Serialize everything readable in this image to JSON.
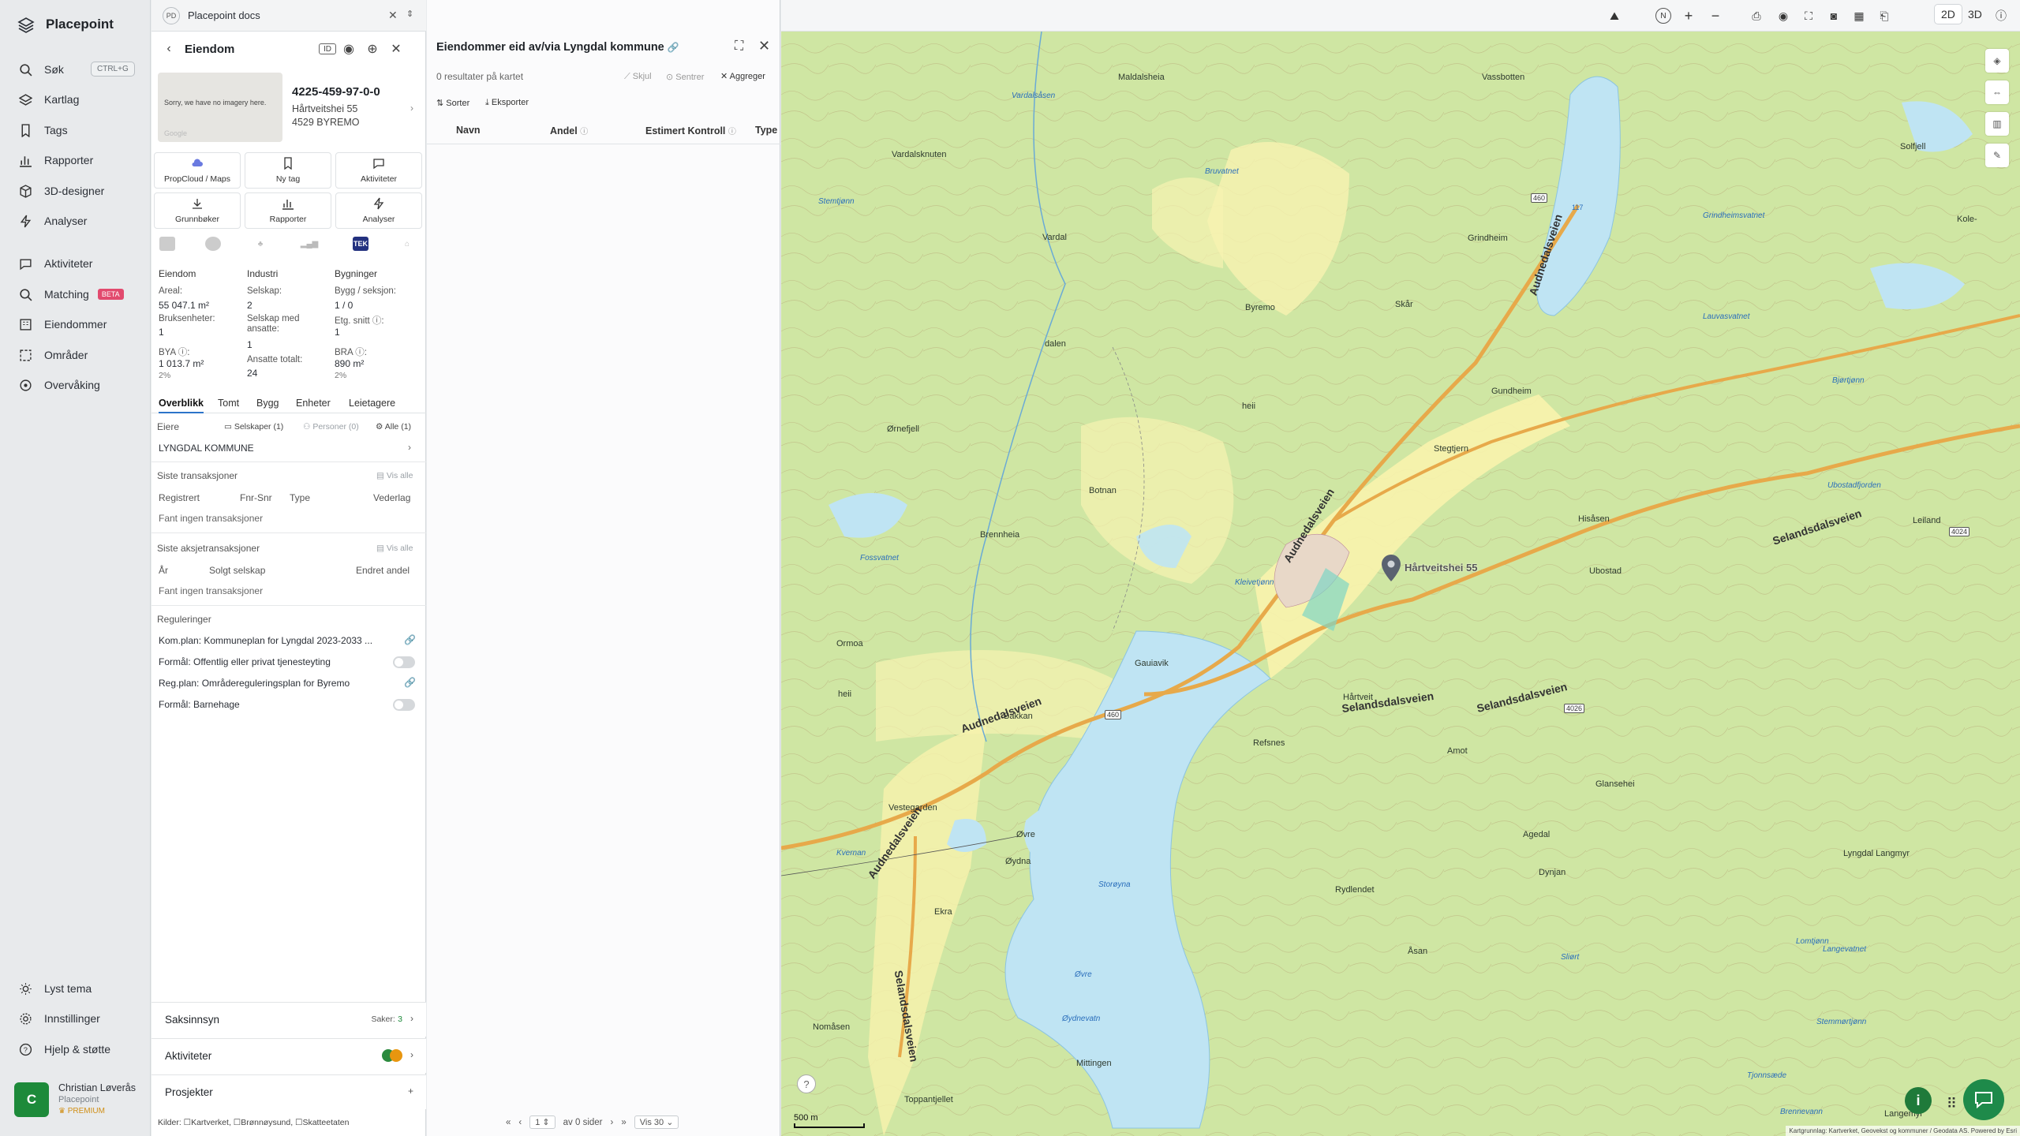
{
  "nav": {
    "brand": "Placepoint",
    "shortcut": "CTRL+G",
    "items": [
      {
        "label": "Søk",
        "icon": "search-icon"
      },
      {
        "label": "Kartlag",
        "icon": "layers-icon"
      },
      {
        "label": "Tags",
        "icon": "bookmark-icon"
      },
      {
        "label": "Rapporter",
        "icon": "chart-icon"
      },
      {
        "label": "3D-designer",
        "icon": "cube-icon"
      },
      {
        "label": "Analyser",
        "icon": "bolt-icon"
      },
      {
        "label": "Aktiviteter",
        "icon": "chat-icon"
      },
      {
        "label": "Matching",
        "icon": "search-icon",
        "badge": "BETA"
      },
      {
        "label": "Eiendommer",
        "icon": "building-icon"
      },
      {
        "label": "Områder",
        "icon": "area-icon"
      },
      {
        "label": "Overvåking",
        "icon": "target-icon"
      }
    ],
    "bottom": [
      {
        "label": "Lyst tema",
        "icon": "sun-icon"
      },
      {
        "label": "Innstillinger",
        "icon": "gear-icon"
      },
      {
        "label": "Hjelp & støtte",
        "icon": "help-icon"
      }
    ],
    "user": {
      "initial": "C",
      "name": "Christian Løverås",
      "org": "Placepoint",
      "plan": "PREMIUM"
    }
  },
  "doc": {
    "badge": "PD",
    "title": "Placepoint docs"
  },
  "property": {
    "header": "Eiendom",
    "no_imagery": "Sorry, we have no imagery here.",
    "google": "Google",
    "id": "4225-459-97-0-0",
    "street": "Hårtveitshei 55",
    "postal": "4529 BYREMO",
    "tiles": [
      {
        "label": "PropCloud / Maps"
      },
      {
        "label": "Ny tag"
      },
      {
        "label": "Aktiviteter"
      },
      {
        "label": "Grunnbøker"
      },
      {
        "label": "Rapporter"
      },
      {
        "label": "Analyser"
      }
    ],
    "sources_chip": "TEK",
    "stats": {
      "col1_title": "Eiendom",
      "col2_title": "Industri",
      "col3_title": "Bygninger",
      "areal_label": "Areal:",
      "areal_val": "55 047.1 m²",
      "selskap_label": "Selskap:",
      "selskap_val": "2",
      "bygg_label": "Bygg / seksjon:",
      "bygg_val": "1 / 0",
      "bruks_label": "Bruksenheter:",
      "bruks_val": "1",
      "ansatte_label": "Selskap med ansatte:",
      "ansatte_val": "1",
      "etg_label": "Etg. snitt ⓘ:",
      "etg_val": "1",
      "bya_label": "BYA ⓘ:",
      "bya_val": "1 013.7 m²",
      "bya_pct": "2%",
      "ans_tot_label": "Ansatte totalt:",
      "ans_tot_val": "24",
      "bra_label": "BRA ⓘ:",
      "bra_val": "890 m²",
      "bra_pct": "2%"
    },
    "tabs": [
      "Overblikk",
      "Tomt",
      "Bygg",
      "Enheter",
      "Leietagere"
    ],
    "owners": {
      "title": "Eiere",
      "f1": "Selskaper (1)",
      "f2": "Personer (0)",
      "f3": "Alle (1)",
      "owner": "LYNGDAL KOMMUNE"
    },
    "trans": {
      "title": "Siste transaksjoner",
      "link": "Vis alle",
      "cols": [
        "Registrert",
        "Fnr-Snr",
        "Type",
        "Vederlag"
      ],
      "empty": "Fant ingen transaksjoner"
    },
    "share": {
      "title": "Siste aksjetransaksjoner",
      "link": "Vis alle",
      "cols": [
        "År",
        "Solgt selskap",
        "Endret andel"
      ],
      "empty": "Fant ingen transaksjoner"
    },
    "reg": {
      "title": "Reguleringer",
      "r1": "Kom.plan: Kommuneplan for Lyngdal 2023-2033 ...",
      "r2": "Formål: Offentlig eller privat tjenesteyting",
      "r3": "Reg.plan: Områdereguleringsplan for Byremo",
      "r4": "Formål: Barnehage"
    },
    "acc": [
      {
        "title": "Saksinnsyn",
        "right_label": "Saker:",
        "right_val": "3"
      },
      {
        "title": "Aktiviteter"
      },
      {
        "title": "Prosjekter"
      }
    ],
    "sources": "Kilder: ☐Kartverket, ☐Brønnøysund, ☐Skatteetaten"
  },
  "results": {
    "title": "Eiendommer eid av/via Lyngdal kommune",
    "count": "0 resultater på kartet",
    "hide": "Skjul",
    "center": "Sentrer",
    "aggregate": "Aggreger",
    "sort": "Sorter",
    "export": "Eksporter",
    "cols": [
      "Navn",
      "Andel",
      "Estimert Kontroll",
      "Type"
    ],
    "pager": {
      "page": "1",
      "of": "av 0 sider",
      "per": "Vis 30"
    }
  },
  "map": {
    "modes": [
      "2D",
      "3D"
    ],
    "scale": "500 m",
    "attribution": "Kartgrunnlag: Kartverket, Geovekst og kommuner / Geodata AS. Powered by Esri",
    "pin_label": "Hårtveitshei 55",
    "labels": [
      "Maldalsheia",
      "Vassbotten",
      "Vardalsåsen",
      "Vardalsknuten",
      "Stemtjønn",
      "Vardal",
      "Bruvatnet",
      "Grindheim",
      "Grindheimsvatnet",
      "Byremo",
      "Skår",
      "Lauvasvatnet",
      "dalen",
      "heii",
      "Bjørtjønn",
      "Gundheim",
      "Ørnefjell",
      "Stegtjern",
      "Botnan",
      "Brennheia",
      "Hisåsen",
      "Ubostadfjorden",
      "Fossvatnet",
      "Kleivetjønn",
      "Ormoa",
      "Gauiavik",
      "heii",
      "Bakkan",
      "Refsnes",
      "Hårtveit",
      "Amot",
      "Glansehei",
      "Vestegarden",
      "Øvre",
      "Øydna",
      "Storøyna",
      "Ekra",
      "Agedal",
      "Rydlendet",
      "Dynjan",
      "Åsan",
      "Øvre",
      "Øydnevatn",
      "Nomåsen",
      "Mittingen",
      "Toppantjellet",
      "Langemyr",
      "Ubostad",
      "Leiland",
      "Kole-",
      "Solfjell",
      "Brennevann",
      "Kvernan",
      "Sliørt",
      "Lomtjønn",
      "Langevatnet",
      "Stemmørtjønn",
      "Tjonnsæde",
      "Lyngdal Langmyr"
    ],
    "roads": [
      "Audnedalsveien",
      "Audnedalsveien",
      "Audnedalsveien",
      "Audnedalsveien",
      "Selandsdalsveien",
      "Selandsdalsveien",
      "Selandsdalsveien",
      "Selandsdalsveien"
    ],
    "rnums": [
      "117",
      "460",
      "460",
      "4024",
      "4026"
    ]
  }
}
